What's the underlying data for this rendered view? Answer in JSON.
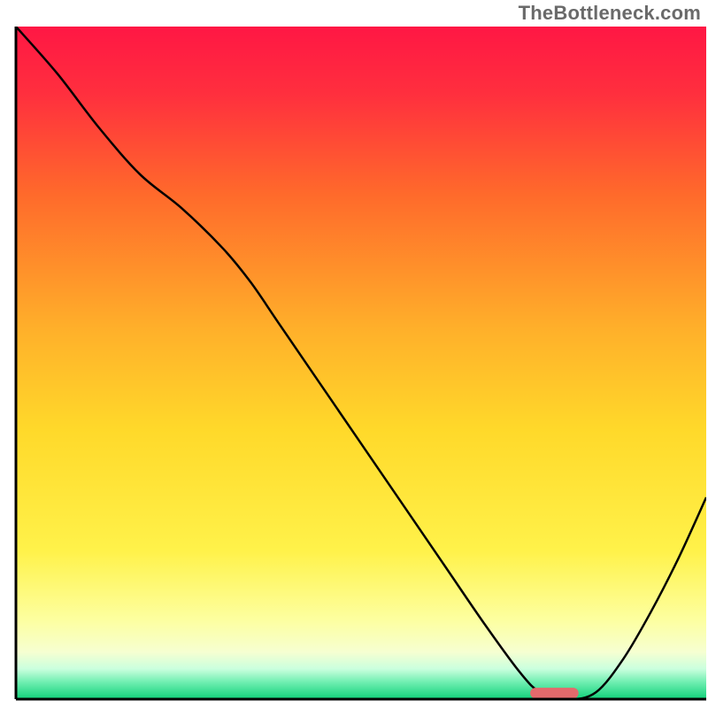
{
  "watermark": "TheBottleneck.com",
  "chart_data": {
    "type": "line",
    "title": "",
    "xlabel": "",
    "ylabel": "",
    "xlim": [
      0,
      100
    ],
    "ylim": [
      0,
      100
    ],
    "legend": false,
    "grid": false,
    "background": {
      "type": "vertical-gradient",
      "stops": [
        {
          "pos": 0.0,
          "color": "#ff1744"
        },
        {
          "pos": 0.1,
          "color": "#ff2f3e"
        },
        {
          "pos": 0.25,
          "color": "#ff6a2b"
        },
        {
          "pos": 0.45,
          "color": "#ffb02a"
        },
        {
          "pos": 0.6,
          "color": "#ffd92a"
        },
        {
          "pos": 0.78,
          "color": "#fff24a"
        },
        {
          "pos": 0.88,
          "color": "#fdff9e"
        },
        {
          "pos": 0.93,
          "color": "#f6ffd1"
        },
        {
          "pos": 0.955,
          "color": "#caffde"
        },
        {
          "pos": 0.975,
          "color": "#6eeeb0"
        },
        {
          "pos": 1.0,
          "color": "#11d17a"
        }
      ]
    },
    "series": [
      {
        "name": "bottleneck-curve",
        "color": "#000000",
        "width": 2.5,
        "x": [
          0,
          6,
          12,
          18,
          24,
          30,
          34,
          38,
          44,
          50,
          56,
          62,
          68,
          73,
          76,
          80,
          84,
          88,
          92,
          96,
          100
        ],
        "y": [
          100,
          93,
          85,
          78,
          73,
          67,
          62,
          56,
          47,
          38,
          29,
          20,
          11,
          4,
          1,
          0,
          1,
          6,
          13,
          21,
          30
        ]
      }
    ],
    "marker": {
      "name": "optimal-range",
      "shape": "pill",
      "color": "#e46a6c",
      "x": 78,
      "y": 0.9,
      "width": 7,
      "height": 1.6
    },
    "frame": {
      "left": true,
      "right": false,
      "top": false,
      "bottom": true,
      "color": "#000000",
      "width": 3
    }
  }
}
